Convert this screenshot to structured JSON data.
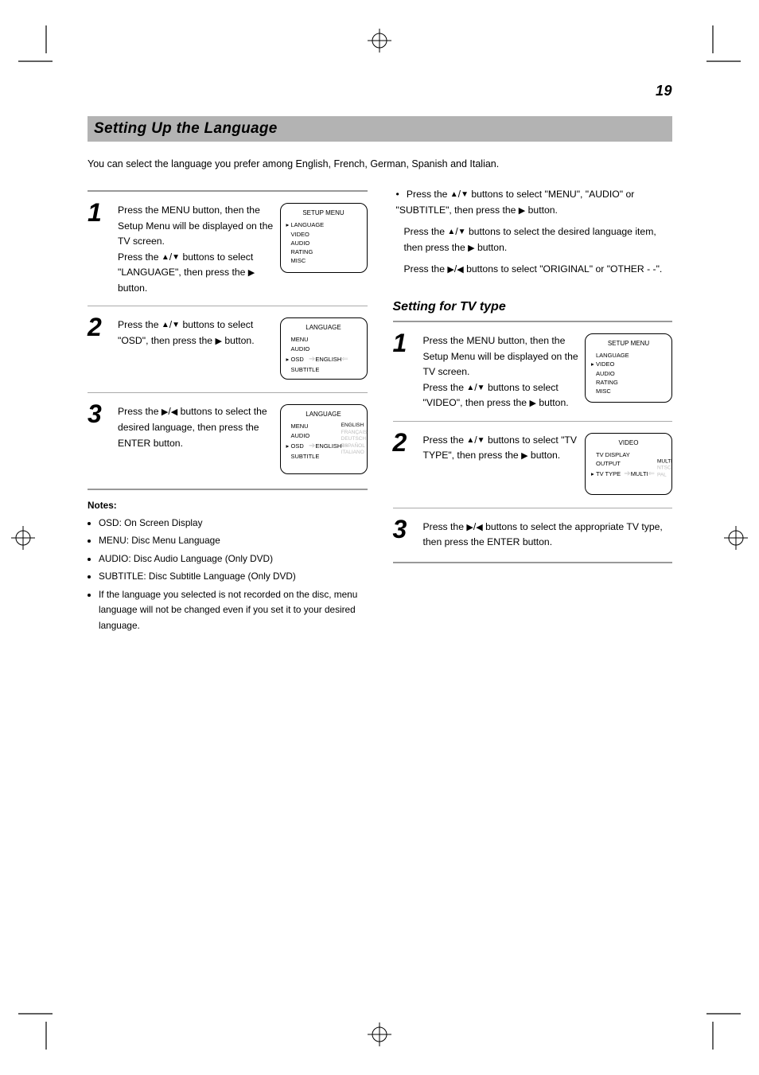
{
  "page_number": "19",
  "banner": "Setting Up the Language",
  "lead": "You can select the language you prefer among English, French, German, Spanish and Italian.",
  "left": {
    "step1": {
      "intro": "Press the MENU button, then the Setup Menu will be displayed on the TV screen.",
      "part_a": "Press the ",
      "part_b": " buttons to select \"LANGUAGE\", then press the ",
      "part_c": " button."
    },
    "step2": {
      "part_a": "Press the ",
      "part_b": " buttons to select \"OSD\", then press the ",
      "part_c": " button."
    },
    "step3": {
      "part_a": "Press the ",
      "part_b": " buttons to select the desired language, then press the ENTER button."
    },
    "notes_head": "Notes:",
    "notes": [
      "OSD: On Screen Display",
      "MENU: Disc Menu Language",
      "AUDIO: Disc Audio Language (Only DVD)",
      "SUBTITLE: Disc Subtitle Language (Only DVD)",
      "If the language you selected is not recorded on the disc, menu language will not be changed even if you set it to your desired language."
    ],
    "panels": {
      "setup": {
        "title": "SETUP MENU",
        "items": [
          "LANGUAGE",
          "VIDEO",
          "AUDIO",
          "RATING",
          "MISC"
        ]
      },
      "lang": {
        "title": "LANGUAGE",
        "items": [
          "OSD",
          "MENU",
          "AUDIO",
          "SUBTITLE"
        ],
        "value": "ENGLISH",
        "langs": [
          "ENGLISH",
          "FRANÇAIS",
          "DEUTSCH",
          "ESPAÑOL",
          "ITALIANO"
        ]
      }
    }
  },
  "right": {
    "top_bullets": {
      "b1_a": "Press the ",
      "b1_b": " buttons to select \"MENU\", \"AUDIO\" or \"SUBTITLE\", then press the ",
      "b1_c": " button.",
      "b2_a": "Press the ",
      "b2_b": " buttons to select the desired language item, then press the ",
      "b2_c": " button.",
      "b3_a": "Press the ",
      "b3_b": " buttons to select \"ORIGINAL\" or \"OTHER - -\"."
    },
    "step1": {
      "intro": "Press the MENU button, then the Setup Menu will be displayed on the TV screen.",
      "part_a": "Press the ",
      "part_b": " buttons to select \"VIDEO\", then press the ",
      "part_c": " button."
    },
    "step2": {
      "part_a": "Press the ",
      "part_b": " buttons to select \"TV TYPE\", then press the ",
      "part_c": " button."
    },
    "step3": {
      "part_a": "Press the ",
      "part_b": " buttons to select the appropriate TV type, then press the ENTER button."
    },
    "subhead": "Setting for TV type",
    "panels": {
      "setup": {
        "title": "SETUP MENU",
        "items": [
          "LANGUAGE",
          "VIDEO",
          "AUDIO",
          "RATING",
          "MISC"
        ]
      },
      "video": {
        "title": "VIDEO",
        "items": [
          "TV TYPE",
          "TV DISPLAY",
          "OUTPUT"
        ],
        "value": "MULTI",
        "types": [
          "MULTI",
          "NTSC",
          "PAL"
        ]
      }
    }
  }
}
